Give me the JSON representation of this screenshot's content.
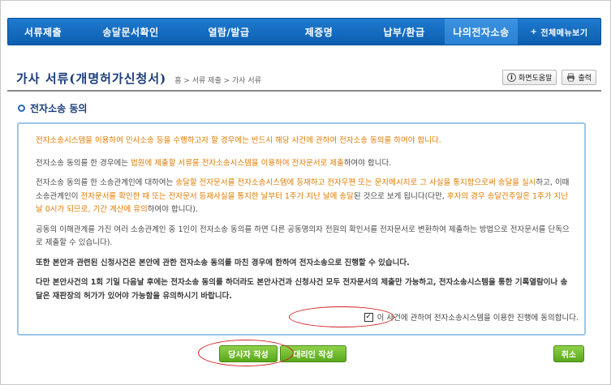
{
  "nav": {
    "items": [
      {
        "label": "서류제출"
      },
      {
        "label": "송달문서확인"
      },
      {
        "label": "열람/발급"
      },
      {
        "label": "제증명"
      },
      {
        "label": "납부/환급"
      },
      {
        "label": "나의전자소송"
      }
    ],
    "all_menu": {
      "plus": "+",
      "label": "전체메뉴보기"
    }
  },
  "header": {
    "title": "가사 서류(개명허가신청서)",
    "breadcrumb": "홈 > 서류 제출 > 가사 서류",
    "help_label": "화면도움말",
    "print_label": "출력"
  },
  "section": {
    "title": "전자소송 동의"
  },
  "notice": {
    "p1": "전자소송시스템을 이용하여 민사소송 등을 수행하고자 할 경우에는 반드시 해당 사건에 관하여 전자소송 동의를 하여야 합니다.",
    "p2a": "전자소송 동의를 한 경우에는 ",
    "p2b": "법원에 제출할 서류를 전자소송시스템을 이용하여 전자문서로 제출",
    "p2c": "하여야 합니다.",
    "p3a": "전자소송 동의를 한 소송관계인에 대하여는 ",
    "p3b": "송달할 전자문서를 전자소송시스템에 등재하고 전자우편 또는 문자메시지로 그 사실을 통지함으로써 송달을 실시",
    "p3c": "하고, 이때 소송관계인이 ",
    "p3d": "전자문서를 확인한 때 또는 전자문서 등재사실을 통지한 날부터 1주가 지난 날에 송달",
    "p3e": "된 것으로 보게 됩니다(다만, ",
    "p3f": "후자의 경우 송달간주일은 1주가 지난 날 0시가 되므로, 기간 계산에 유의",
    "p3g": "하여야 합니다).",
    "p4": "공동의 이해관계를 가진 여러 소송관계인 중 1인이 전자소송 동의를 하면 다른 공동명의자 전원의 확인서를 전자문서로 변환하여 제출하는 방법으로 전자문서를 단독으로 제출할 수 있습니다).",
    "p5": "또한 본안과 관련된 신청사건은 본안에 관한 전자소송 동의를 마친 경우에 한하여 전자소송으로 진행할 수 있습니다.",
    "p6": "다만 본안사건의 1회 기일 다음날 후에는 전자소송 동의를 하더라도 본안사건과 신청사건 모두 전자문서의 제출만 가능하고, 전자소송시스템을 통한 기록열람이나 송달은 재판장의 허가가 있어야 가능함을 유의하시기 바랍니다.",
    "agree_label": "이 사건에 관하여 전자소송시스템을 이용한 진행에 동의합니다.",
    "agree_checked": true
  },
  "buttons": {
    "party": "당사자 작성",
    "proxy": "대리인 작성",
    "cancel": "취소"
  },
  "colors": {
    "nav": "#0d5fb0",
    "highlight": "#e07b00",
    "button": "#59a81b",
    "annotation": "#d12020"
  }
}
